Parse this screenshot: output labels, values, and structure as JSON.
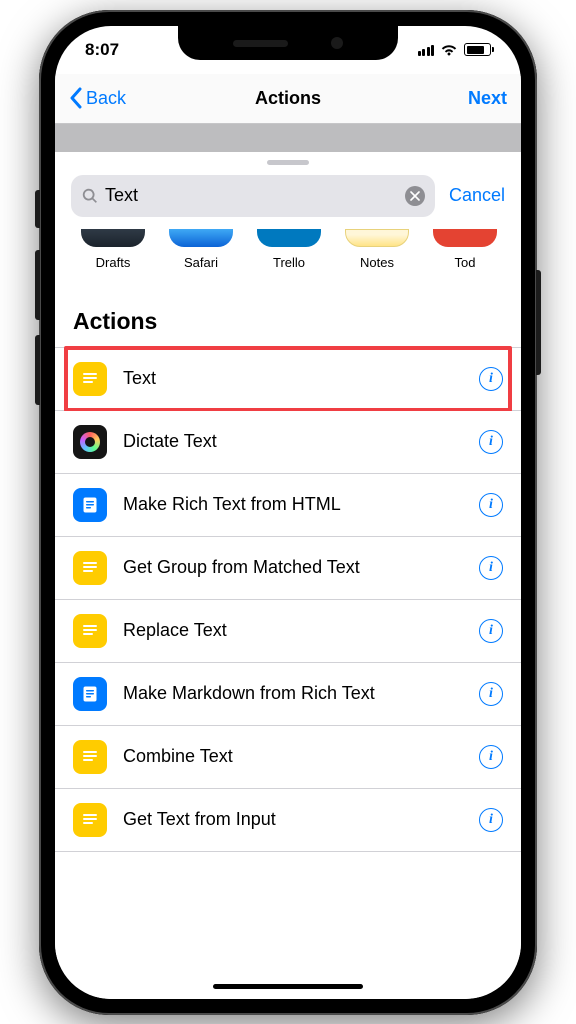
{
  "status": {
    "time": "8:07"
  },
  "nav": {
    "back_label": "Back",
    "title": "Actions",
    "next_label": "Next"
  },
  "search": {
    "value": "Text",
    "cancel_label": "Cancel"
  },
  "apps": [
    {
      "label": "Drafts",
      "css": "drafts"
    },
    {
      "label": "Safari",
      "css": "safari"
    },
    {
      "label": "Trello",
      "css": "trello"
    },
    {
      "label": "Notes",
      "css": "notes"
    },
    {
      "label": "Tod",
      "css": "todos"
    }
  ],
  "section_title": "Actions",
  "actions": [
    {
      "label": "Text",
      "icon": "lines",
      "color": "ic-yellow",
      "highlight": true
    },
    {
      "label": "Dictate Text",
      "icon": "ring",
      "color": "ic-black",
      "highlight": false
    },
    {
      "label": "Make Rich Text from HTML",
      "icon": "doc",
      "color": "ic-blue",
      "highlight": false
    },
    {
      "label": "Get Group from Matched Text",
      "icon": "lines",
      "color": "ic-yellow",
      "highlight": false
    },
    {
      "label": "Replace Text",
      "icon": "lines",
      "color": "ic-yellow",
      "highlight": false
    },
    {
      "label": "Make Markdown from Rich Text",
      "icon": "doc",
      "color": "ic-blue",
      "highlight": false
    },
    {
      "label": "Combine Text",
      "icon": "lines",
      "color": "ic-yellow",
      "highlight": false
    },
    {
      "label": "Get Text from Input",
      "icon": "lines",
      "color": "ic-yellow",
      "highlight": false
    }
  ]
}
